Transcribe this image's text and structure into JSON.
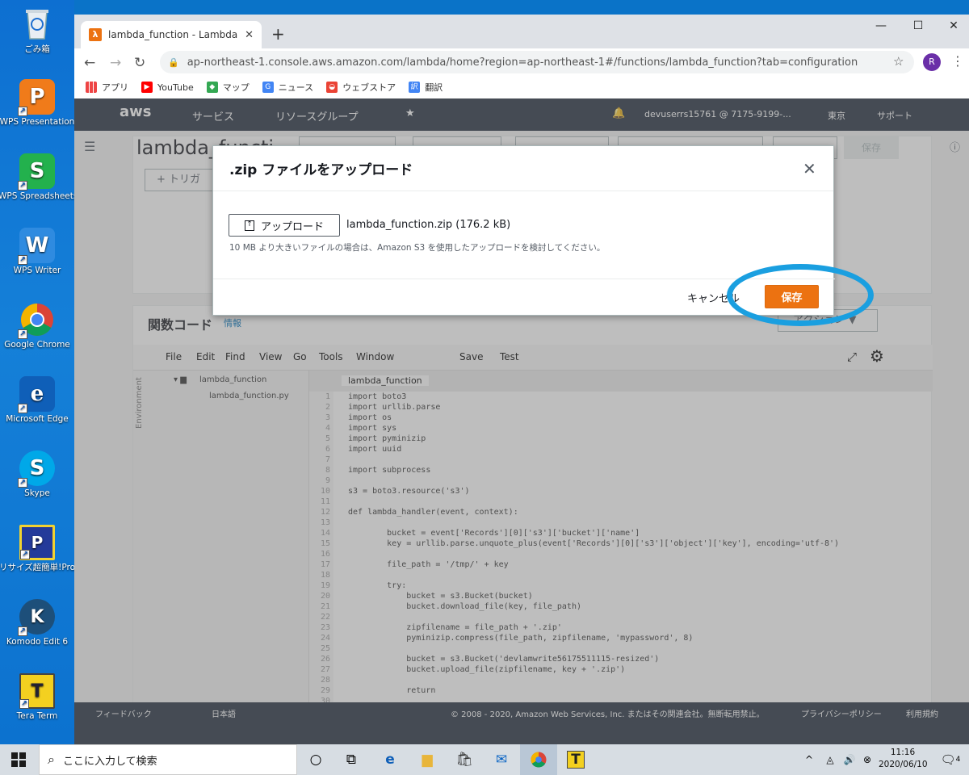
{
  "desktop": {
    "icons": [
      {
        "label": "ごみ箱",
        "icon": "recycle-bin-icon"
      },
      {
        "label": "WPS Presentation",
        "icon": "wps-presentation-icon"
      },
      {
        "label": "WPS Spreadsheets",
        "icon": "wps-spreadsheets-icon"
      },
      {
        "label": "WPS Writer",
        "icon": "wps-writer-icon"
      },
      {
        "label": "Google Chrome",
        "icon": "chrome-icon"
      },
      {
        "label": "Microsoft Edge",
        "icon": "edge-icon"
      },
      {
        "label": "Skype",
        "icon": "skype-icon"
      },
      {
        "label": "リサイズ超簡単!Pro",
        "icon": "resize-pro-icon"
      },
      {
        "label": "Komodo Edit 6",
        "icon": "komodo-icon"
      },
      {
        "label": "Tera Term",
        "icon": "teraterm-icon"
      }
    ]
  },
  "browser": {
    "tab_title": "lambda_function - Lambda",
    "url": "ap-northeast-1.console.aws.amazon.com/lambda/home?region=ap-northeast-1#/functions/lambda_function?tab=configuration",
    "avatar_letter": "R",
    "bookmarks": [
      "アプリ",
      "YouTube",
      "マップ",
      "ニュース",
      "ウェブストア",
      "翻訳"
    ]
  },
  "aws_header": {
    "logo": "aws",
    "services": "サービス",
    "resource_groups": "リソースグループ",
    "account": "devuserrs15761 @ 7175-9199-...",
    "region": "東京",
    "support": "サポート"
  },
  "console": {
    "function_title": "lambda_functi",
    "save_label": "保存",
    "trigger_label": "+ トリガ",
    "code_section_title": "関数コード",
    "info_link": "情報",
    "actions_label": "アクション",
    "editor_menu": [
      "File",
      "Edit",
      "Find",
      "View",
      "Go",
      "Tools",
      "Window"
    ],
    "save_btn": "Save",
    "test_btn": "Test",
    "env_label": "Environment",
    "folder": "lambda_function",
    "file": "lambda_function.py",
    "editor_tab": "lambda_function",
    "code_lines": [
      "import boto3",
      "import urllib.parse",
      "import os",
      "import sys",
      "import pyminizip",
      "import uuid",
      "",
      "import subprocess",
      "",
      "s3 = boto3.resource('s3')",
      "",
      "def lambda_handler(event, context):",
      "",
      "        bucket = event['Records'][0]['s3']['bucket']['name']",
      "        key = urllib.parse.unquote_plus(event['Records'][0]['s3']['object']['key'], encoding='utf-8')",
      "",
      "        file_path = '/tmp/' + key",
      "",
      "        try:",
      "            bucket = s3.Bucket(bucket)",
      "            bucket.download_file(key, file_path)",
      "",
      "            zipfilename = file_path + '.zip'",
      "            pyminizip.compress(file_path, zipfilename, 'mypassword', 8)",
      "",
      "            bucket = s3.Bucket('devlamwrite56175511115-resized')",
      "            bucket.upload_file(zipfilename, key + '.zip')",
      "",
      "            return",
      ""
    ],
    "footer_feedback": "フィードバック",
    "footer_lang": "日本語",
    "footer_copyright": "© 2008 - 2020, Amazon Web Services, Inc. またはその関連会社。無断転用禁止。",
    "footer_privacy": "プライバシーポリシー",
    "footer_terms": "利用規約"
  },
  "modal": {
    "title": ".zip ファイルをアップロード",
    "upload_button": "アップロード",
    "file_name": "lambda_function.zip (176.2 kB)",
    "hint": "10 MB より大きいファイルの場合は、Amazon S3 を使用したアップロードを検討してください。",
    "cancel": "キャンセル",
    "save": "保存",
    "highlight_color": "#1a9fe0",
    "save_color": "#ec7211"
  },
  "taskbar": {
    "search_placeholder": "ここに入力して検索",
    "time": "11:16",
    "date": "2020/06/10",
    "notification_count": "4"
  }
}
